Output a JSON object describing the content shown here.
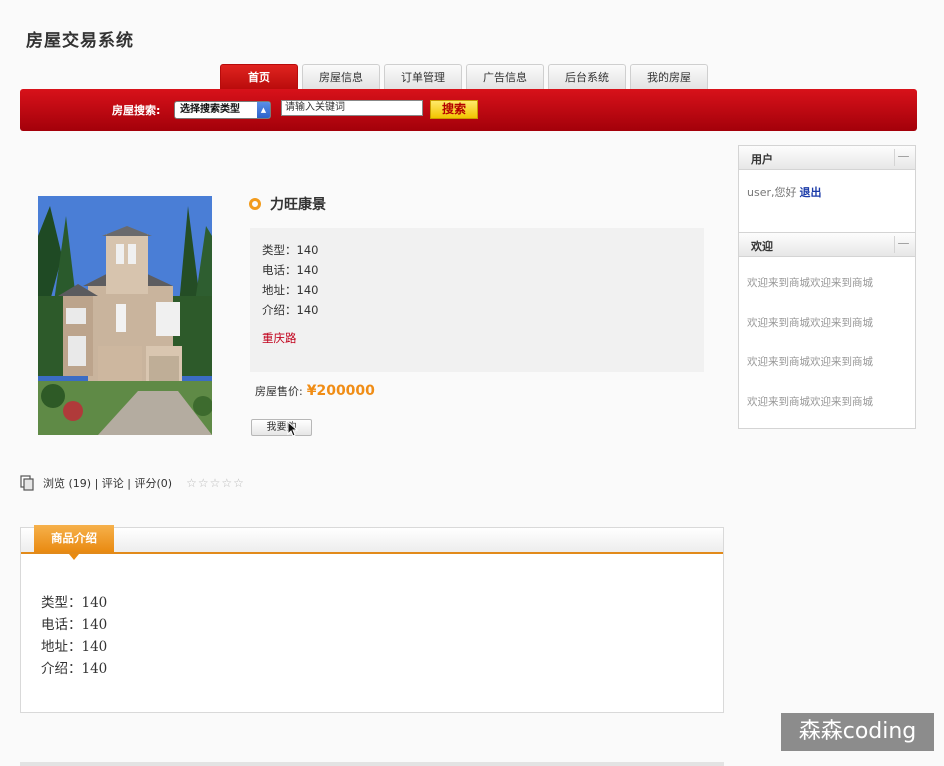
{
  "header": {
    "title": "房屋交易系统"
  },
  "nav": {
    "tabs": [
      {
        "label": "首页",
        "active": true
      },
      {
        "label": "房屋信息",
        "active": false
      },
      {
        "label": "订单管理",
        "active": false
      },
      {
        "label": "广告信息",
        "active": false
      },
      {
        "label": "后台系统",
        "active": false
      },
      {
        "label": "我的房屋",
        "active": false
      }
    ]
  },
  "search": {
    "label": "房屋搜索:",
    "select_value": "选择搜索类型",
    "input_value": "请输入关键词",
    "button_label": "搜索"
  },
  "product": {
    "name": "力旺康景",
    "details": [
      "类型：140",
      "电话：140",
      "地址：140",
      "介绍：140"
    ],
    "address": "重庆路",
    "price_label": "房屋售价:",
    "price_value": "¥200000",
    "buy_button": "我要购",
    "stats": "浏览 (19) | 评论 | 评分(0)",
    "stars": "☆☆☆☆☆"
  },
  "user_panel": {
    "title": "用户",
    "greeting": "user,您好",
    "logout": "退出"
  },
  "welcome_panel": {
    "title": "欢迎",
    "items": [
      "欢迎来到商城欢迎来到商城",
      "欢迎来到商城欢迎来到商城",
      "欢迎来到商城欢迎来到商城",
      "欢迎来到商城欢迎来到商城"
    ]
  },
  "intro_section": {
    "tab_label": "商品介绍",
    "rows": [
      "类型：140",
      "电话：140",
      "地址：140",
      "介绍：140"
    ]
  },
  "watermark": "森森coding",
  "colors": {
    "brand_red": "#c40a12",
    "accent_orange": "#e98a11",
    "link_blue": "#1a3aa8",
    "address_red": "#c1001b"
  }
}
